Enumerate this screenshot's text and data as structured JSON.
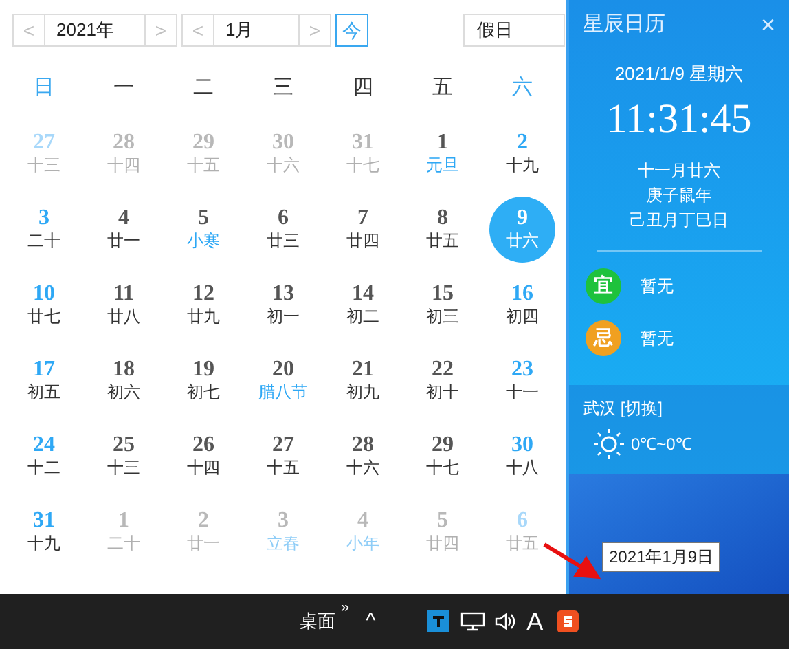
{
  "toolbar": {
    "year": "2021年",
    "month": "1月",
    "prev": "<",
    "next": ">",
    "today_button": "今",
    "holiday_field": "假日"
  },
  "weekdays": [
    {
      "label": "日",
      "weekend": true
    },
    {
      "label": "一",
      "weekend": false
    },
    {
      "label": "二",
      "weekend": false
    },
    {
      "label": "三",
      "weekend": false
    },
    {
      "label": "四",
      "weekend": false
    },
    {
      "label": "五",
      "weekend": false
    },
    {
      "label": "六",
      "weekend": true
    }
  ],
  "days": [
    {
      "day": "27",
      "lunar": "十三",
      "in_month": false,
      "weekend": true,
      "festival": false,
      "selected": false
    },
    {
      "day": "28",
      "lunar": "十四",
      "in_month": false,
      "weekend": false,
      "festival": false,
      "selected": false
    },
    {
      "day": "29",
      "lunar": "十五",
      "in_month": false,
      "weekend": false,
      "festival": false,
      "selected": false
    },
    {
      "day": "30",
      "lunar": "十六",
      "in_month": false,
      "weekend": false,
      "festival": false,
      "selected": false
    },
    {
      "day": "31",
      "lunar": "十七",
      "in_month": false,
      "weekend": false,
      "festival": false,
      "selected": false
    },
    {
      "day": "1",
      "lunar": "元旦",
      "in_month": true,
      "weekend": false,
      "festival": true,
      "selected": false
    },
    {
      "day": "2",
      "lunar": "十九",
      "in_month": true,
      "weekend": true,
      "festival": false,
      "selected": false
    },
    {
      "day": "3",
      "lunar": "二十",
      "in_month": true,
      "weekend": true,
      "festival": false,
      "selected": false
    },
    {
      "day": "4",
      "lunar": "廿一",
      "in_month": true,
      "weekend": false,
      "festival": false,
      "selected": false
    },
    {
      "day": "5",
      "lunar": "小寒",
      "in_month": true,
      "weekend": false,
      "festival": true,
      "selected": false
    },
    {
      "day": "6",
      "lunar": "廿三",
      "in_month": true,
      "weekend": false,
      "festival": false,
      "selected": false
    },
    {
      "day": "7",
      "lunar": "廿四",
      "in_month": true,
      "weekend": false,
      "festival": false,
      "selected": false
    },
    {
      "day": "8",
      "lunar": "廿五",
      "in_month": true,
      "weekend": false,
      "festival": false,
      "selected": false
    },
    {
      "day": "9",
      "lunar": "廿六",
      "selected": true
    },
    {
      "day": "10",
      "lunar": "廿七",
      "in_month": true,
      "weekend": true,
      "festival": false,
      "selected": false
    },
    {
      "day": "11",
      "lunar": "廿八",
      "in_month": true,
      "weekend": false,
      "festival": false,
      "selected": false
    },
    {
      "day": "12",
      "lunar": "廿九",
      "in_month": true,
      "weekend": false,
      "festival": false,
      "selected": false
    },
    {
      "day": "13",
      "lunar": "初一",
      "in_month": true,
      "weekend": false,
      "festival": false,
      "selected": false
    },
    {
      "day": "14",
      "lunar": "初二",
      "in_month": true,
      "weekend": false,
      "festival": false,
      "selected": false
    },
    {
      "day": "15",
      "lunar": "初三",
      "in_month": true,
      "weekend": false,
      "festival": false,
      "selected": false
    },
    {
      "day": "16",
      "lunar": "初四",
      "in_month": true,
      "weekend": true,
      "festival": false,
      "selected": false
    },
    {
      "day": "17",
      "lunar": "初五",
      "in_month": true,
      "weekend": true,
      "festival": false,
      "selected": false
    },
    {
      "day": "18",
      "lunar": "初六",
      "in_month": true,
      "weekend": false,
      "festival": false,
      "selected": false
    },
    {
      "day": "19",
      "lunar": "初七",
      "in_month": true,
      "weekend": false,
      "festival": false,
      "selected": false
    },
    {
      "day": "20",
      "lunar": "腊八节",
      "in_month": true,
      "weekend": false,
      "festival": true,
      "selected": false
    },
    {
      "day": "21",
      "lunar": "初九",
      "in_month": true,
      "weekend": false,
      "festival": false,
      "selected": false
    },
    {
      "day": "22",
      "lunar": "初十",
      "in_month": true,
      "weekend": false,
      "festival": false,
      "selected": false
    },
    {
      "day": "23",
      "lunar": "十一",
      "in_month": true,
      "weekend": true,
      "festival": false,
      "selected": false
    },
    {
      "day": "24",
      "lunar": "十二",
      "in_month": true,
      "weekend": true,
      "festival": false,
      "selected": false
    },
    {
      "day": "25",
      "lunar": "十三",
      "in_month": true,
      "weekend": false,
      "festival": false,
      "selected": false
    },
    {
      "day": "26",
      "lunar": "十四",
      "in_month": true,
      "weekend": false,
      "festival": false,
      "selected": false
    },
    {
      "day": "27",
      "lunar": "十五",
      "in_month": true,
      "weekend": false,
      "festival": false,
      "selected": false
    },
    {
      "day": "28",
      "lunar": "十六",
      "in_month": true,
      "weekend": false,
      "festival": false,
      "selected": false
    },
    {
      "day": "29",
      "lunar": "十七",
      "in_month": true,
      "weekend": false,
      "festival": false,
      "selected": false
    },
    {
      "day": "30",
      "lunar": "十八",
      "in_month": true,
      "weekend": true,
      "festival": false,
      "selected": false
    },
    {
      "day": "31",
      "lunar": "十九",
      "in_month": true,
      "weekend": true,
      "festival": false,
      "selected": false
    },
    {
      "day": "1",
      "lunar": "二十",
      "in_month": false,
      "weekend": false,
      "festival": false,
      "selected": false
    },
    {
      "day": "2",
      "lunar": "廿一",
      "in_month": false,
      "weekend": false,
      "festival": false,
      "selected": false
    },
    {
      "day": "3",
      "lunar": "立春",
      "in_month": false,
      "weekend": false,
      "festival": true,
      "selected": false
    },
    {
      "day": "4",
      "lunar": "小年",
      "in_month": false,
      "weekend": false,
      "festival": true,
      "selected": false
    },
    {
      "day": "5",
      "lunar": "廿四",
      "in_month": false,
      "weekend": false,
      "festival": false,
      "selected": false
    },
    {
      "day": "6",
      "lunar": "廿五",
      "in_month": false,
      "weekend": true,
      "festival": false,
      "selected": false
    }
  ],
  "side_panel": {
    "title": "星辰日历",
    "close": "×",
    "date": "2021/1/9 星期六",
    "time": "11:31:45",
    "lunar_lines": [
      "十一月廿六",
      "庚子鼠年",
      "己丑月丁巳日"
    ],
    "advice": [
      {
        "badge": "宜",
        "text": "暂无",
        "color": "#1ec23c"
      },
      {
        "badge": "忌",
        "text": "暂无",
        "color": "#f0a020"
      }
    ],
    "city": "武汉 [切换]",
    "temperature": "0℃~0℃"
  },
  "taskbar": {
    "desktop": "桌面",
    "more": "»",
    "show_hidden": "^",
    "ime": "A",
    "tooltip": "2021年1月9日"
  }
}
